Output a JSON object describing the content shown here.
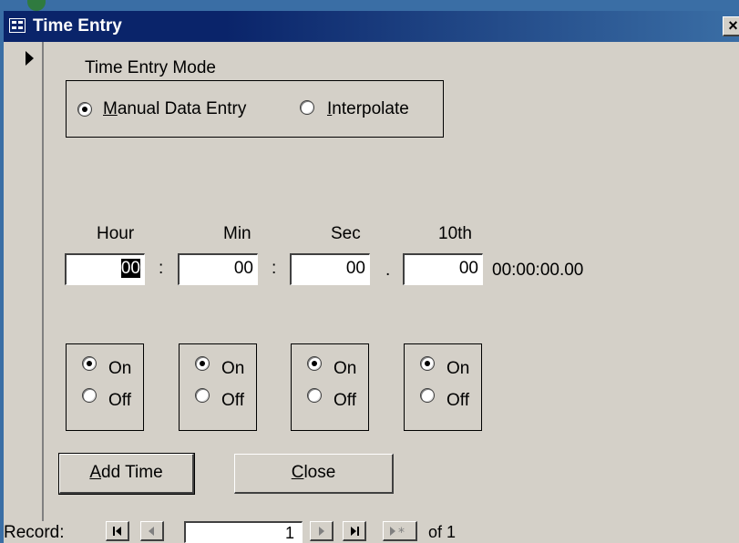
{
  "window": {
    "title": "Time Entry",
    "close_label": "×"
  },
  "mode": {
    "label": "Time Entry Mode",
    "options": [
      {
        "label": "Manual Data Entry",
        "mnemonic": "M",
        "rest": "anual Data Entry",
        "selected": true
      },
      {
        "label": "Interpolate",
        "mnemonic": "I",
        "rest": "nterpolate",
        "selected": false
      }
    ]
  },
  "time": {
    "hour_label": "Hour",
    "min_label": "Min",
    "sec_label": "Sec",
    "tenth_label": "10th",
    "hour": "00",
    "min": "00",
    "sec": "00",
    "tenth": "00",
    "sep_colon": ":",
    "sep_dot": ".",
    "display": "00:00:00.00"
  },
  "toggles": [
    {
      "on_label": "On",
      "off_label": "Off",
      "value": "On"
    },
    {
      "on_label": "On",
      "off_label": "Off",
      "value": "On"
    },
    {
      "on_label": "On",
      "off_label": "Off",
      "value": "On"
    },
    {
      "on_label": "On",
      "off_label": "Off",
      "value": "On"
    }
  ],
  "buttons": {
    "add_time": {
      "mnemonic": "A",
      "rest": "dd Time"
    },
    "close": {
      "mnemonic": "C",
      "rest": "lose"
    }
  },
  "navigation": {
    "record_label": "Record:",
    "current": "1",
    "of_text": "of  1"
  }
}
